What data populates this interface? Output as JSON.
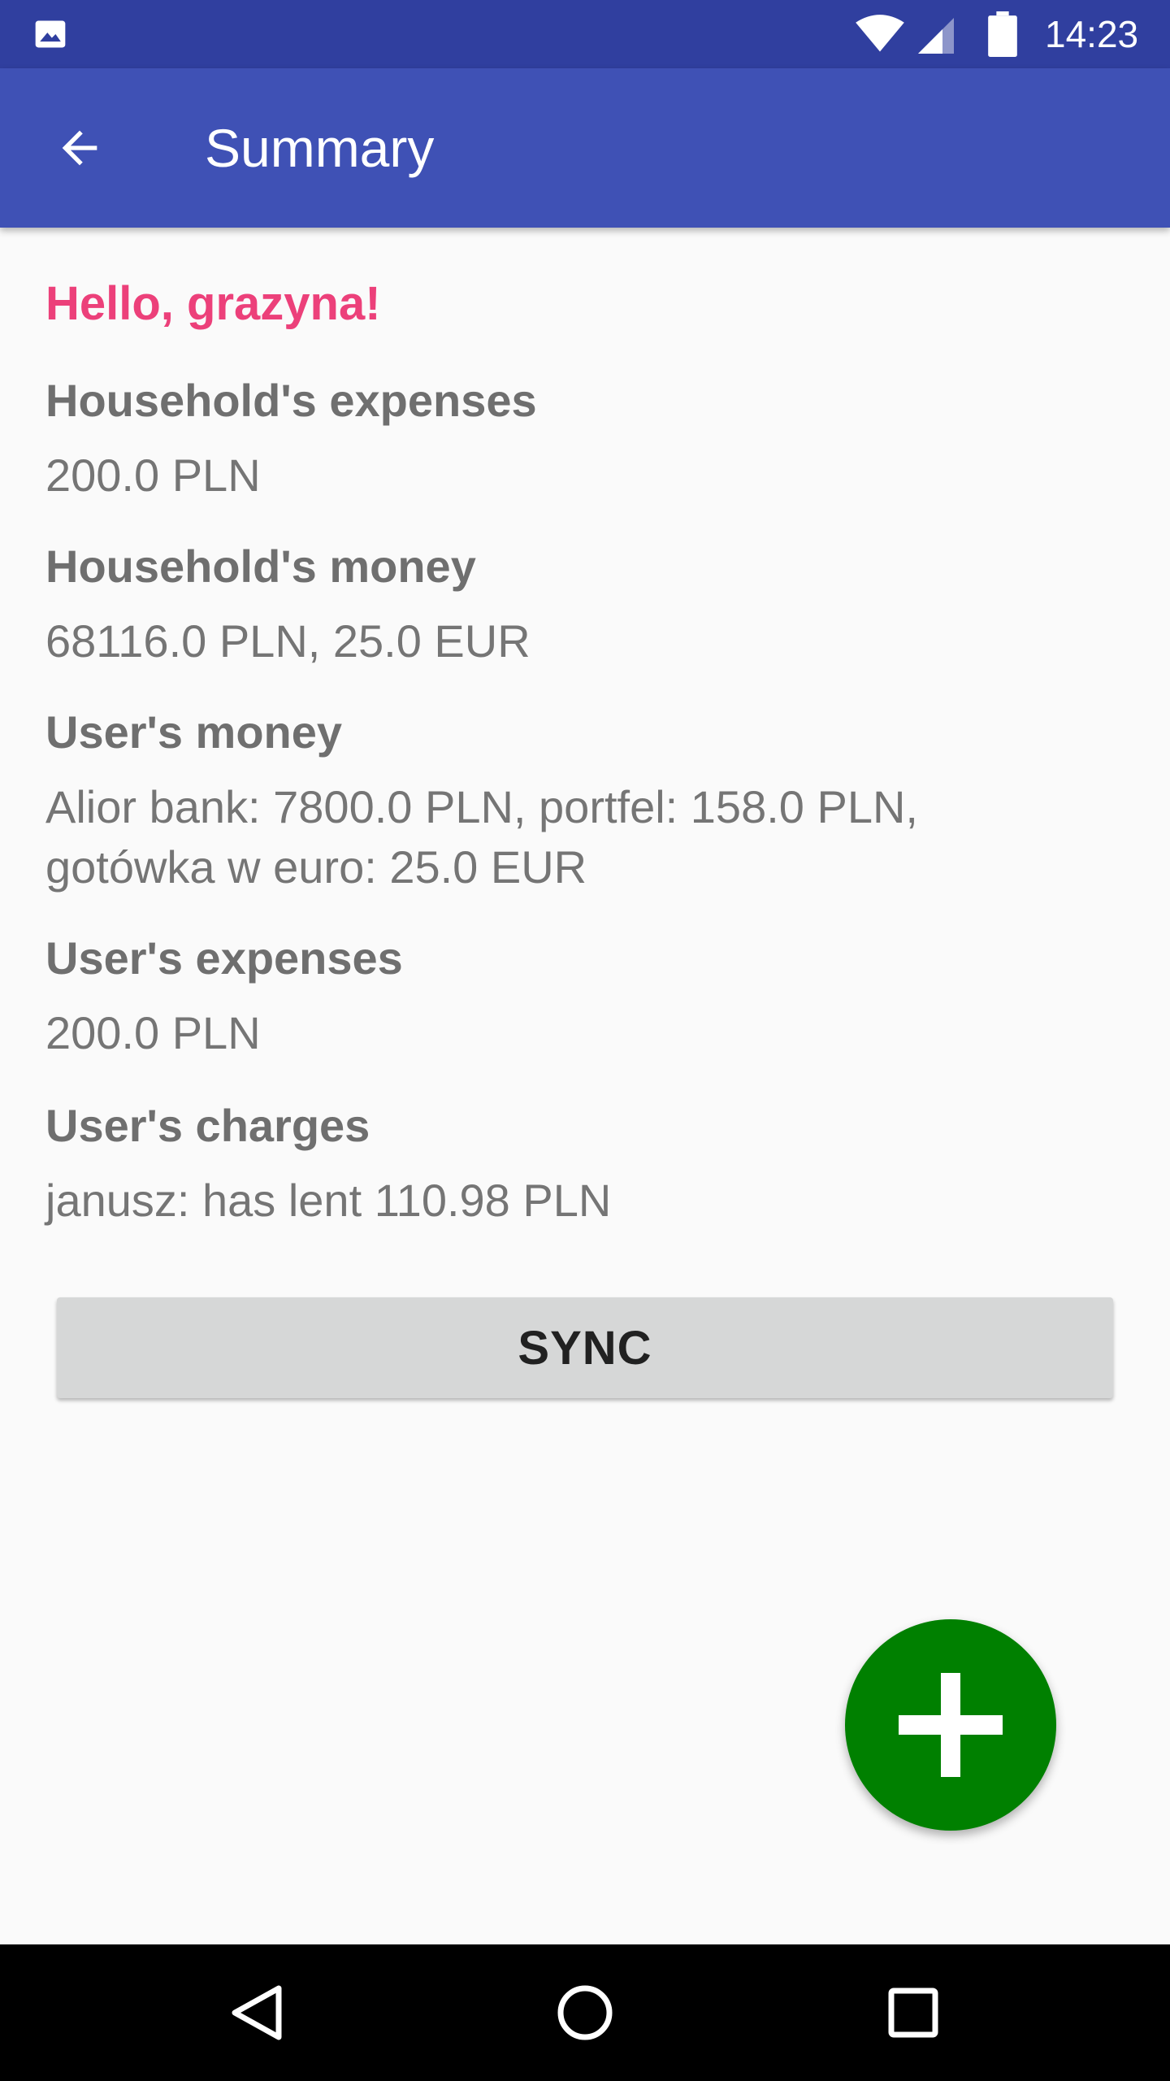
{
  "status_bar": {
    "time": "14:23",
    "icons": [
      "image-notification-icon",
      "wifi-icon",
      "cell-signal-icon",
      "battery-icon"
    ]
  },
  "app_bar": {
    "title": "Summary",
    "back_icon": "arrow-back-icon"
  },
  "summary": {
    "greeting": "Hello, grazyna!",
    "household_expenses": {
      "label": "Household's expenses",
      "value": "200.0 PLN"
    },
    "household_money": {
      "label": "Household's money",
      "value": "68116.0 PLN, 25.0 EUR"
    },
    "users_money": {
      "label": "User's money",
      "value": "Alior bank: 7800.0 PLN, portfel: 158.0 PLN, gotówka w euro: 25.0 EUR"
    },
    "users_expenses": {
      "label": "User's expenses",
      "value": "200.0 PLN"
    },
    "users_charges": {
      "label": "User's charges",
      "value": "janusz: has lent 110.98 PLN"
    }
  },
  "actions": {
    "sync_label": "SYNC",
    "fab_icon": "plus-icon"
  },
  "nav_bar": {
    "icons": [
      "nav-back-icon",
      "nav-home-icon",
      "nav-recents-icon"
    ]
  },
  "colors": {
    "status_bar": "#303F9F",
    "app_bar": "#3F51B5",
    "greeting": "#EC407A",
    "fab": "#008000",
    "button": "#D6D7D7"
  }
}
